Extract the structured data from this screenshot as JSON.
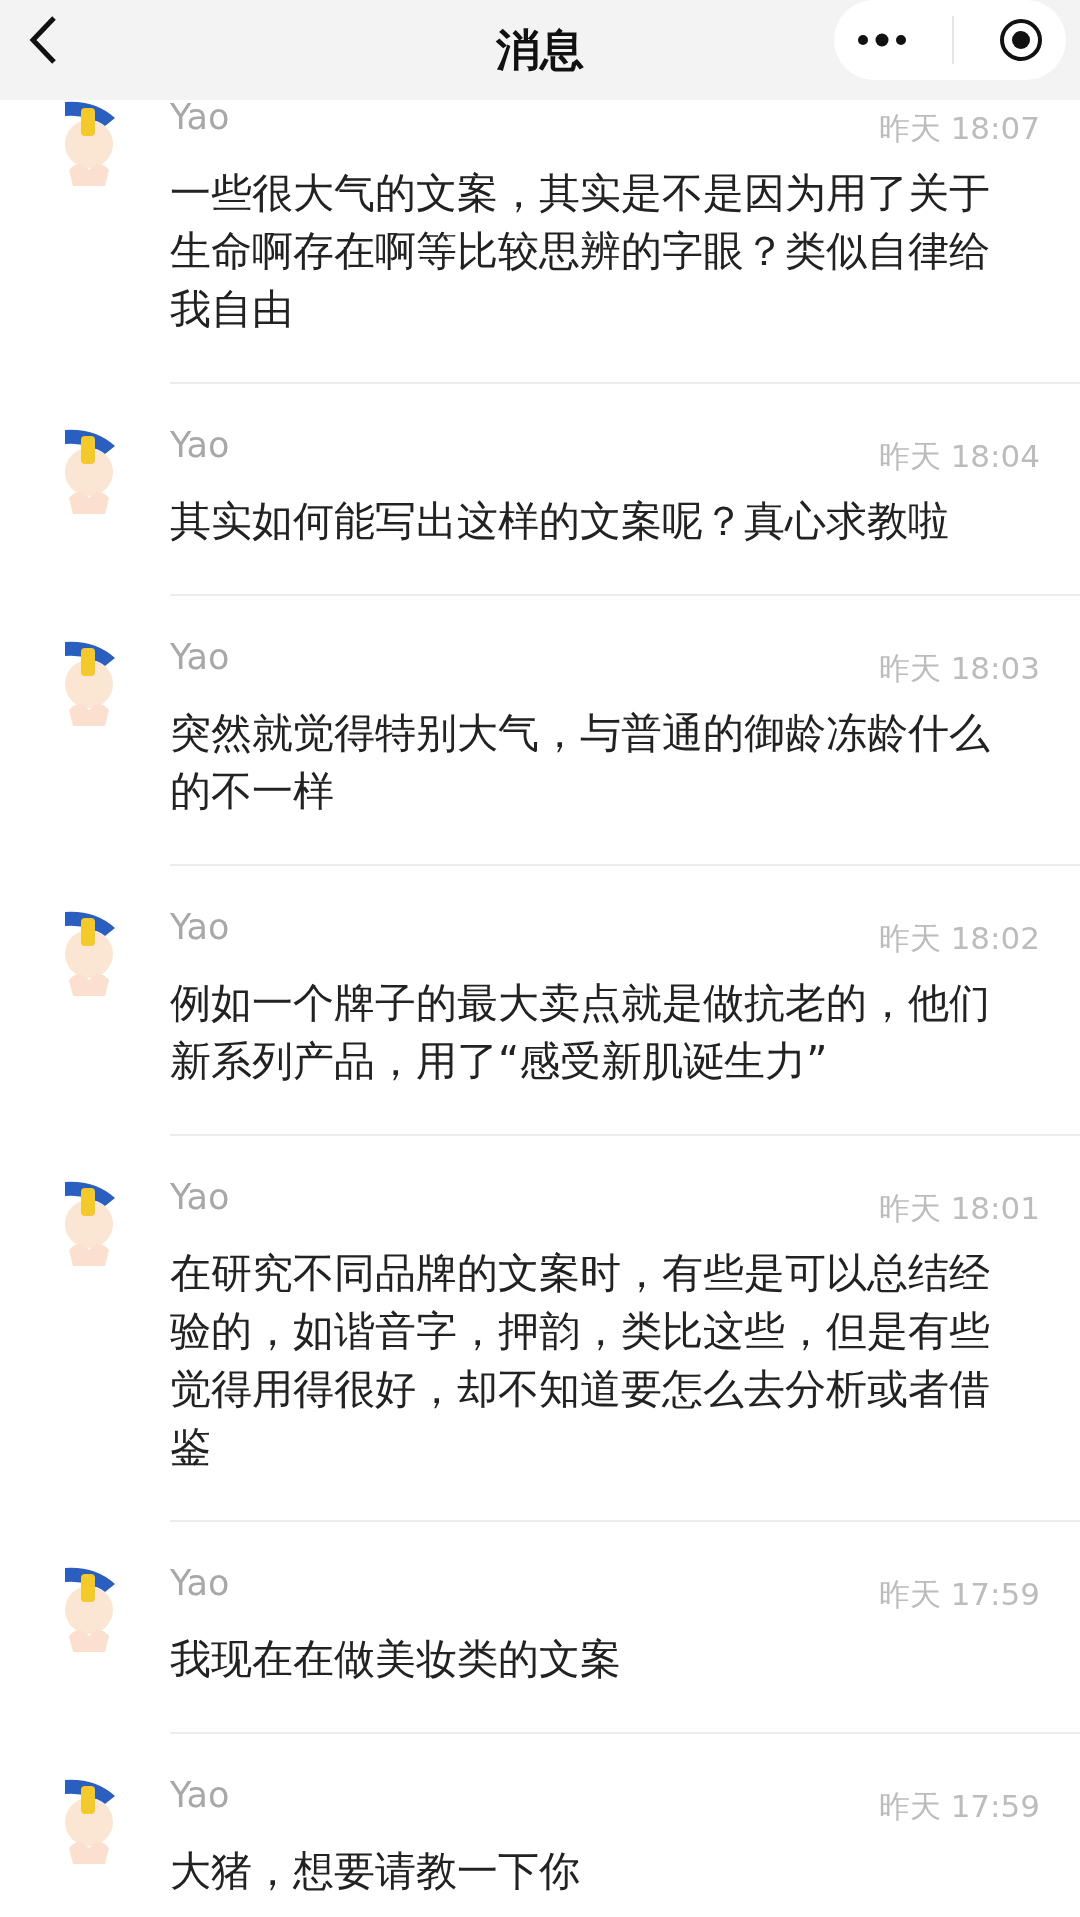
{
  "header": {
    "title": "消息"
  },
  "messages": [
    {
      "name": "Yao",
      "time": "昨天 18:07",
      "text": "一些很大气的文案，其实是不是因为用了关于生命啊存在啊等比较思辨的字眼？类似自律给我自由"
    },
    {
      "name": "Yao",
      "time": "昨天 18:04",
      "text": "其实如何能写出这样的文案呢？真心求教啦"
    },
    {
      "name": "Yao",
      "time": "昨天 18:03",
      "text": "突然就觉得特别大气，与普通的御龄冻龄什么的不一样"
    },
    {
      "name": "Yao",
      "time": "昨天 18:02",
      "text": "例如一个牌子的最大卖点就是做抗老的，他们新系列产品，用了“感受新肌诞生力”"
    },
    {
      "name": "Yao",
      "time": "昨天 18:01",
      "text": "在研究不同品牌的文案时，有些是可以总结经验的，如谐音字，押韵，类比这些，但是有些觉得用得很好，却不知道要怎么去分析或者借鉴"
    },
    {
      "name": "Yao",
      "time": "昨天 17:59",
      "text": "我现在在做美妆类的文案"
    },
    {
      "name": "Yao",
      "time": "昨天 17:59",
      "text": "大猪，想要请教一下你"
    }
  ]
}
